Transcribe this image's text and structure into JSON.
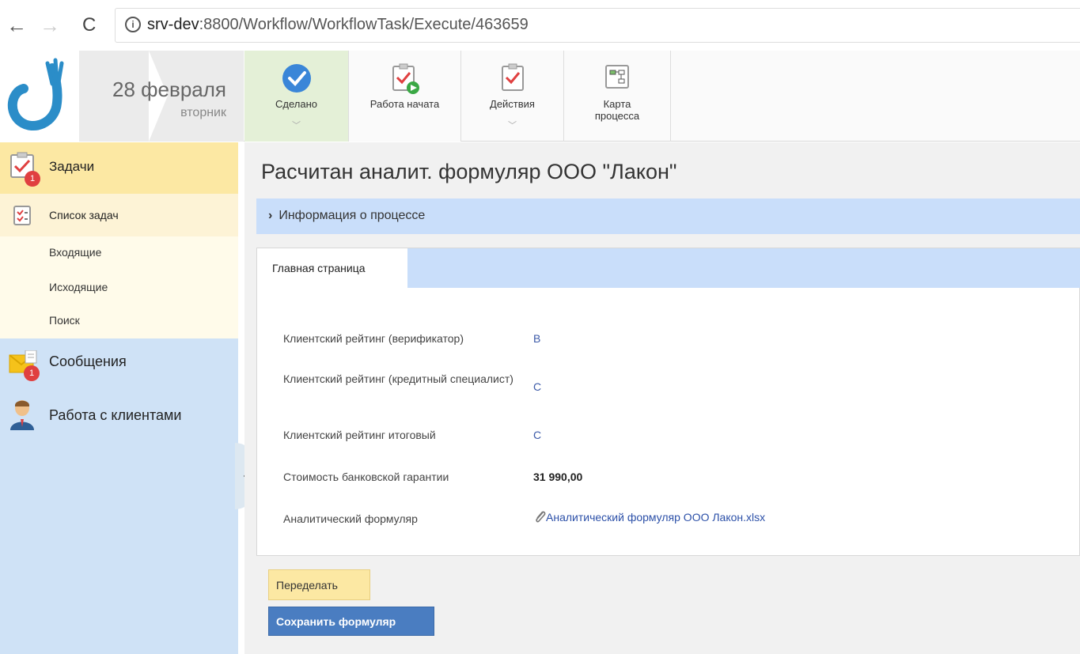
{
  "browser": {
    "url_host": "srv-dev",
    "url_path": ":8800/Workflow/WorkflowTask/Execute/463659"
  },
  "header": {
    "date_day": "28 февраля",
    "date_weekday": "вторник",
    "toolbar": {
      "done_label": "Сделано",
      "started_label": "Работа начата",
      "actions_label": "Действия",
      "map_label_1": "Карта",
      "map_label_2": "процесса"
    }
  },
  "sidebar": {
    "tasks_label": "Задачи",
    "tasks_badge": "1",
    "task_list_label": "Список задач",
    "sub_items": [
      "Входящие",
      "Исходящие",
      "Поиск"
    ],
    "messages_label": "Сообщения",
    "messages_badge": "1",
    "clients_label": "Работа с клиентами",
    "collapse_glyph": "‹"
  },
  "main": {
    "title": "Расчитан аналит. формуляр ООО \"Лакон\"",
    "process_info": "Информация о процессе",
    "tab_label": "Главная страница",
    "fields": [
      {
        "label": "Клиентский рейтинг (верификатор)",
        "value": "B"
      },
      {
        "label": "Клиентский рейтинг (кредитный специалист)",
        "value": "C"
      },
      {
        "label": "Клиентский рейтинг итоговый",
        "value": "C"
      },
      {
        "label": "Стоимость банковской гарантии",
        "value": "31 990,00"
      },
      {
        "label": "Аналитический формуляр",
        "value": "Аналитический формуляр ООО Лакон.xlsx"
      }
    ],
    "redo_button": "Переделать",
    "save_button": "Сохранить формуляр"
  },
  "colors": {
    "done_bg": "#e4f0d7",
    "tasks_bg": "#fce8a3",
    "sidebar_bg": "#cfe2f6",
    "accent_blue": "#4a7dc1",
    "info_bar": "#c9defa"
  }
}
